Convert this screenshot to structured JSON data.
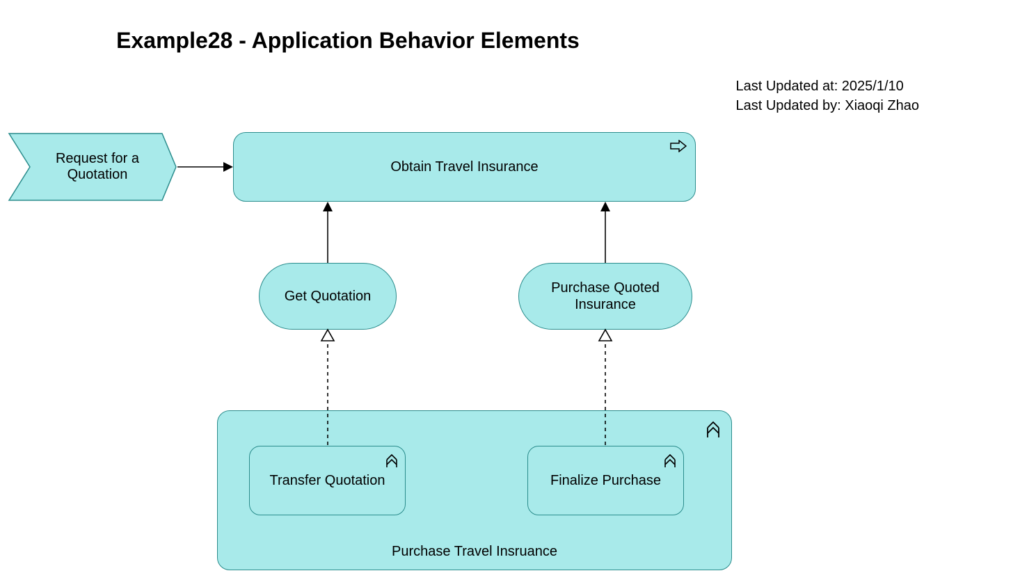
{
  "title": "Example28 - Application Behavior Elements",
  "meta": {
    "updated_at_label": "Last Updated at: 2025/1/10",
    "updated_by_label": "Last Updated by: Xiaoqi Zhao"
  },
  "nodes": {
    "request_quotation": "Request for a\nQuotation",
    "obtain_travel_insurance": "Obtain Travel Insurance",
    "get_quotation": "Get Quotation",
    "purchase_quoted_insurance": "Purchase Quoted\nInsurance",
    "transfer_quotation": "Transfer Quotation",
    "finalize_purchase": "Finalize Purchase",
    "purchase_travel_insurance": "Purchase Travel Insruance"
  },
  "colors": {
    "fill": "#a8eaea",
    "stroke": "#2a8c8c"
  }
}
